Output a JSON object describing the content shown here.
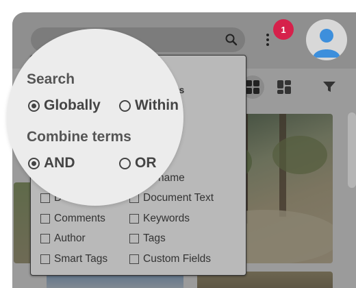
{
  "topbar": {
    "notification_count": "1"
  },
  "options_panel": {
    "fragment_results": "lts",
    "fragment_name": "name",
    "fields": [
      {
        "label": "D",
        "checked": false
      },
      {
        "label": "Document Text",
        "checked": false
      },
      {
        "label": "Comments",
        "checked": false
      },
      {
        "label": "Keywords",
        "checked": false
      },
      {
        "label": "Author",
        "checked": false
      },
      {
        "label": "Tags",
        "checked": false
      },
      {
        "label": "Smart Tags",
        "checked": false
      },
      {
        "label": "Custom Fields",
        "checked": false
      }
    ]
  },
  "magnifier": {
    "search_heading": "Search",
    "search_options": [
      {
        "label": "Globally",
        "selected": true
      },
      {
        "label": "Within",
        "selected": false
      }
    ],
    "combine_heading": "Combine terms",
    "combine_options": [
      {
        "label": "AND",
        "selected": true
      },
      {
        "label": "OR",
        "selected": false
      }
    ]
  },
  "colors": {
    "notification_badge": "#d6214b",
    "avatar": "#3d8fdc"
  }
}
